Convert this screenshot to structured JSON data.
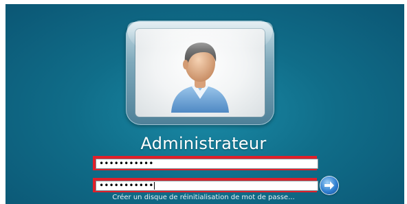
{
  "user": {
    "name": "Administrateur"
  },
  "fields": {
    "password_mask": "•••••••••••",
    "confirm_mask": "•••••••••••"
  },
  "links": {
    "reset_disk": "Créer un disque de réinitialisation de mot de passe..."
  },
  "colors": {
    "background": "#106d89",
    "highlight_border": "#e0202a",
    "submit_button": "#2f7fd0"
  },
  "icons": {
    "avatar": "user-silhouette-icon",
    "submit": "arrow-right-icon"
  }
}
